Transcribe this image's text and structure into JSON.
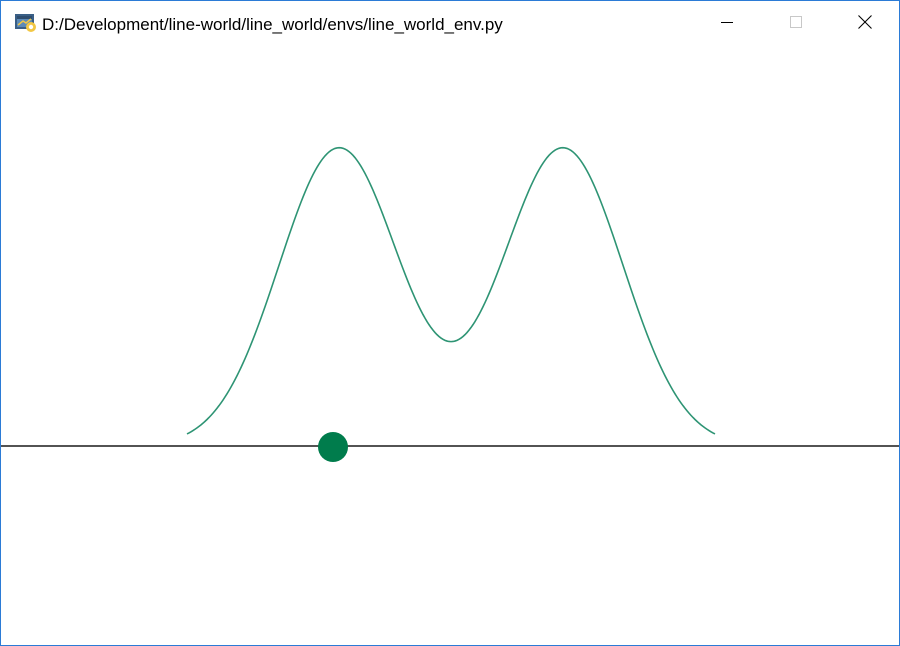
{
  "window": {
    "title": "D:/Development/line-world/line_world/envs/line_world_env.py",
    "icon": "python-app-icon",
    "controls": {
      "minimize_icon": "minimize-icon",
      "maximize_icon": "maximize-icon",
      "close_icon": "close-icon"
    }
  },
  "scene": {
    "curve_color": "#2e9474",
    "baseline_color": "#1a1a1a",
    "agent_color": "#007c4c",
    "curve_peaks": 2,
    "agent_marker": "agent-dot"
  }
}
